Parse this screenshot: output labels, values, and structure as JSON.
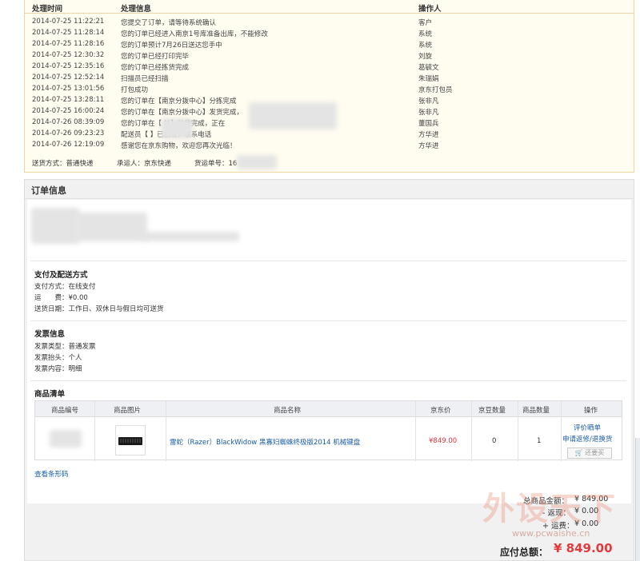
{
  "tracking": {
    "headers": {
      "time": "处理时间",
      "info": "处理信息",
      "operator": "操作人"
    },
    "rows": [
      {
        "time": "2014-07-25 11:22:21",
        "info": "您提交了订单，请等待系统确认",
        "operator": "客户"
      },
      {
        "time": "2014-07-25 11:28:14",
        "info": "您的订单已经进入南京1号库准备出库，不能修改",
        "operator": "系统"
      },
      {
        "time": "2014-07-25 11:28:16",
        "info": "您的订单预计7月26日送达您手中",
        "operator": "系统"
      },
      {
        "time": "2014-07-25 12:30:32",
        "info": "您的订单已经打印完毕",
        "operator": "刘旋"
      },
      {
        "time": "2014-07-25 12:35:16",
        "info": "您的订单已经拣货完成",
        "operator": "葛毓文"
      },
      {
        "time": "2014-07-25 12:52:14",
        "info": "扫描员已经扫描",
        "operator": "朱瑞娟"
      },
      {
        "time": "2014-07-25 13:01:56",
        "info": "打包成功",
        "operator": "京东打包员"
      },
      {
        "time": "2014-07-25 13:28:11",
        "info": "您的订单在【南京分拨中心】分拣完成",
        "operator": "张非凡"
      },
      {
        "time": "2014-07-25 16:00:24",
        "info": "您的订单在【南京分拨中心】发货完成，",
        "operator": "张非凡"
      },
      {
        "time": "2014-07-26 08:39:09",
        "info": "您的订单在【 站】验货完成，正在",
        "operator": "董国兵"
      },
      {
        "time": "2014-07-26 09:23:23",
        "info": "配送员【 】已出发，联系电话",
        "operator": "方华进"
      },
      {
        "time": "2014-07-26 12:19:09",
        "info": "感谢您在京东购物，欢迎您再次光临！",
        "operator": "方华进"
      }
    ],
    "footer": {
      "shipping_method": "送货方式：普通快递",
      "carrier": "承运人：京东快递",
      "tracking_no": "货运单号：16"
    }
  },
  "order": {
    "title": "订单信息",
    "payment": {
      "title": "支付及配送方式",
      "method": "支付方式：在线支付",
      "freight": "运　　费：¥0.00",
      "delivery_date": "送货日期：工作日、双休日与假日均可送货"
    },
    "invoice": {
      "title": "发票信息",
      "type": "发票类型：普通发票",
      "header": "发票抬头：个人",
      "content": "发票内容：明细"
    },
    "products": {
      "title": "商品清单",
      "columns": [
        "商品编号",
        "商品图片",
        "商品名称",
        "京东价",
        "京豆数量",
        "商品数量",
        "操作"
      ],
      "items": [
        {
          "name": "雷蛇（Razer）BlackWidow 黑寡妇蜘蛛终极版2014 机械键盘",
          "price": "¥849.00",
          "beans": "0",
          "qty": "1",
          "actions": [
            "评价晒单",
            "申请返修/退换货"
          ],
          "rebuy": "还要买"
        }
      ],
      "barcode_link": "查看条形码"
    },
    "totals": {
      "goods_label": "总商品金额：",
      "goods_value": "¥ 849.00",
      "rebate_label": "- 返现：",
      "rebate_value": "¥ 0.00",
      "freight_label": "+ 运费：",
      "freight_value": "¥ 0.00",
      "grand_label": "应付总额：",
      "grand_value": "¥ 849.00"
    }
  },
  "watermark": {
    "text": "外设天下",
    "url": "www.pcwaishe.cn"
  },
  "colors": {
    "accent_red": "#e4393c",
    "link_blue": "#1a5ca8",
    "track_bg": "#fffdf0",
    "track_border": "#f0d79b"
  }
}
